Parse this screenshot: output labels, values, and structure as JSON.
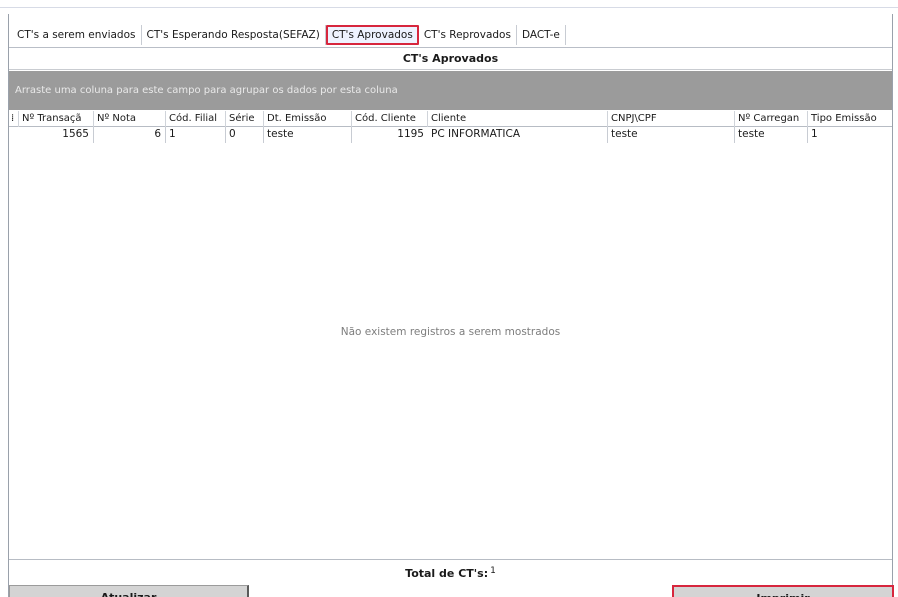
{
  "tabs": [
    {
      "label": "CT's a serem enviados",
      "active": false
    },
    {
      "label": "CT's Esperando Resposta(SEFAZ)",
      "active": false
    },
    {
      "label": "CT's Aprovados",
      "active": true
    },
    {
      "label": "CT's Reprovados",
      "active": false
    },
    {
      "label": "DACT-e",
      "active": false
    }
  ],
  "panel": {
    "title": "CT's Aprovados",
    "group_hint": "Arraste uma coluna para este campo para agrupar os dados por esta coluna"
  },
  "grid": {
    "row_indicator": "⁞",
    "columns": [
      "Nº Transaçã",
      "Nº Nota",
      "Cód. Filial",
      "Série",
      "Dt. Emissão",
      "Cód. Cliente",
      "Cliente",
      "CNPJ\\CPF",
      "Nº Carregan",
      "Tipo Emissão"
    ],
    "rows": [
      [
        "1565",
        "6",
        "1",
        "0",
        "teste",
        "1195",
        "PC INFORMATICA",
        "teste",
        "teste",
        "1"
      ]
    ],
    "empty_message": "Não existem registros a serem mostrados"
  },
  "footer": {
    "total_label": "Total de CT's:",
    "total_value": "1"
  },
  "buttons": {
    "update_label": "Atualizar",
    "print_label": "Imprimir"
  },
  "colors": {
    "highlight": "#d7263d",
    "group_band": "#9b9b9b"
  }
}
